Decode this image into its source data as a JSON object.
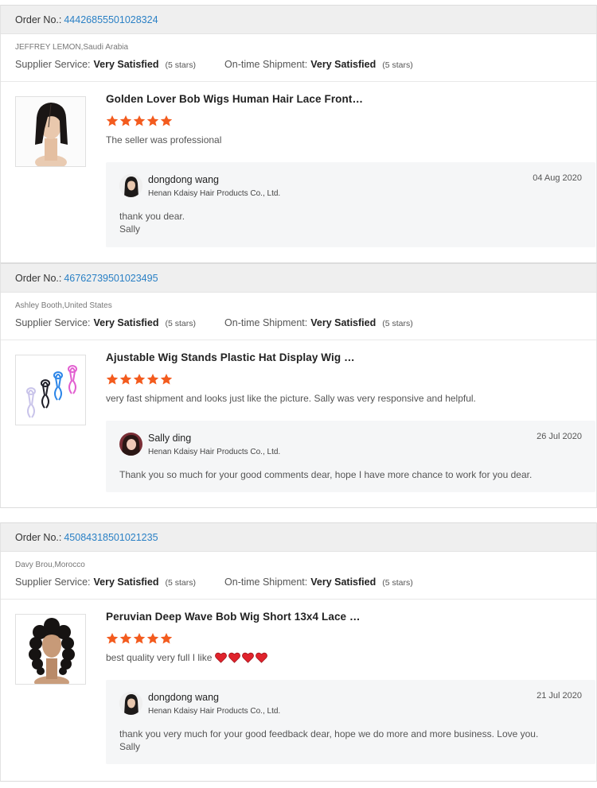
{
  "labels": {
    "order_no": "Order No.:",
    "supplier_service": "Supplier Service:",
    "ontime_shipment": "On-time Shipment:"
  },
  "colors": {
    "link": "#2a80c5",
    "star": "#f35b1e",
    "heart": "#e0232c",
    "order_bar": "#efefef",
    "reply_bg": "#f5f6f7"
  },
  "reviews": [
    {
      "order_number": "44426855501028324",
      "buyer": "JEFFREY LEMON,Saudi Arabia",
      "supplier_rating": "Very Satisfied",
      "supplier_stars": "(5 stars)",
      "shipment_rating": "Very Satisfied",
      "shipment_stars": "(5 stars)",
      "product_icon": "bob-wig-straight-image",
      "product_title": "Golden Lover Bob Wigs Human Hair Lace Front…",
      "rating": 5,
      "comment": "The seller was professional",
      "reply": {
        "author": "dongdong wang",
        "avatar_icon": "female-avatar-dark-hair",
        "company": "Henan Kdaisy Hair Products Co., Ltd.",
        "date": "04 Aug 2020",
        "line1": "thank you dear.",
        "line2": "Sally"
      }
    },
    {
      "order_number": "46762739501023495",
      "buyer": "Ashley Booth,United States",
      "supplier_rating": "Very Satisfied",
      "supplier_stars": "(5 stars)",
      "shipment_rating": "Very Satisfied",
      "shipment_stars": "(5 stars)",
      "product_icon": "wig-stands-image",
      "product_title": "Ajustable Wig Stands Plastic Hat Display Wig …",
      "rating": 5,
      "comment": "very fast shipment and looks just like the picture. Sally was very responsive and helpful.",
      "reply": {
        "author": "Sally ding",
        "avatar_icon": "female-avatar-photo",
        "company": "Henan Kdaisy Hair Products Co., Ltd.",
        "date": "26 Jul 2020",
        "line1": "Thank you so much for your good comments dear, hope I have more chance to work for you dear.",
        "line2": ""
      }
    },
    {
      "order_number": "45084318501021235",
      "buyer": "Davy Brou,Morocco",
      "supplier_rating": "Very Satisfied",
      "supplier_stars": "(5 stars)",
      "shipment_rating": "Very Satisfied",
      "shipment_stars": "(5 stars)",
      "product_icon": "deep-wave-wig-image",
      "product_title": "Peruvian Deep Wave Bob Wig Short 13x4 Lace …",
      "rating": 5,
      "comment": "best quality very full I like",
      "comment_hearts": 4,
      "reply": {
        "author": "dongdong wang",
        "avatar_icon": "female-avatar-dark-hair",
        "company": "Henan Kdaisy Hair Products Co., Ltd.",
        "date": "21 Jul 2020",
        "line1": "thank you very much for your good feedback dear, hope we do more and more business. Love you.",
        "line2": "Sally"
      }
    }
  ]
}
